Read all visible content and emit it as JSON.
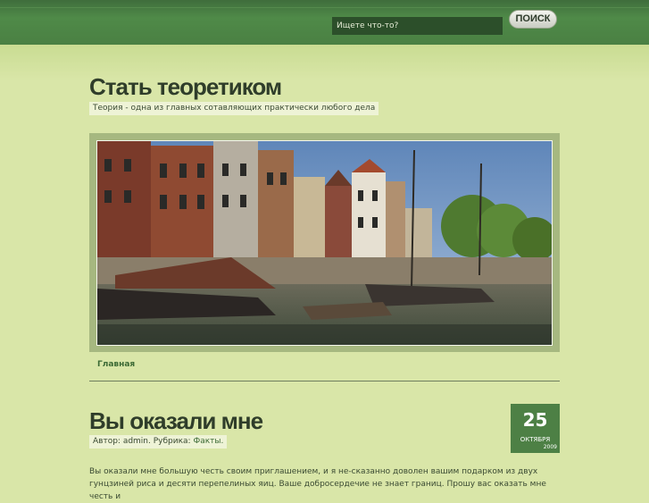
{
  "search": {
    "placeholder": "Ищете что-то?",
    "button_label": "ПОИСК"
  },
  "site": {
    "title": "Стать теоретиком",
    "tagline": "Теория - одна из главных сотавляющих практически любого дела"
  },
  "header_image": {
    "description_icon": "canal-boats-photo"
  },
  "nav": {
    "items": [
      {
        "label": "Главная"
      }
    ]
  },
  "post": {
    "title": "Вы оказали мне",
    "meta_prefix": "Автор: admin. Рубрика:",
    "category": "Факты.",
    "date_day": "25",
    "date_month": "октября",
    "date_year": "2009",
    "body": "Вы оказали мне большую честь своим приглашением, и я не-сказанно доволен вашим подарком из двух гунцзиней риса и десяти перепелиных яиц. Ваше добросердечие не знает границ. Прошу вас оказать мне честь и"
  },
  "colors": {
    "page_bg": "#d9e6a8",
    "topbar": "#4a8043",
    "accent": "#4d8045"
  }
}
